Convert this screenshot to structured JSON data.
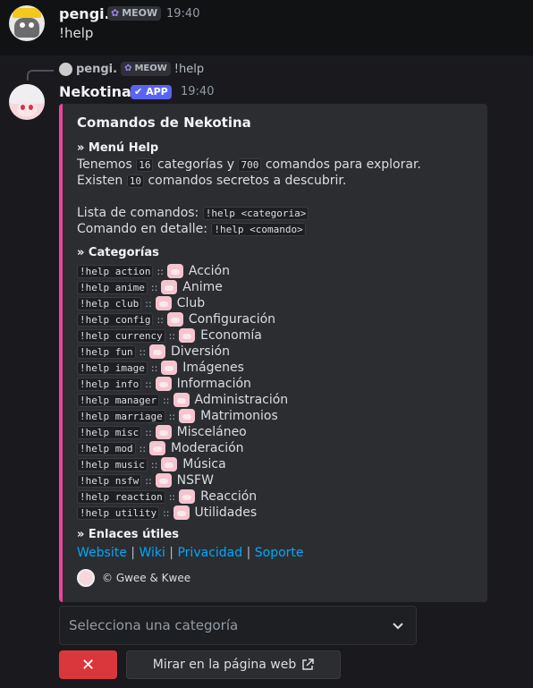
{
  "message1": {
    "username": "pengi.",
    "tag": "MEOW",
    "time": "19:40",
    "text": "!help"
  },
  "reply": {
    "username": "pengi.",
    "tag": "MEOW",
    "text": "!help"
  },
  "message2": {
    "username": "Nekotina",
    "app_tag": "APP",
    "time": "19:40"
  },
  "embed": {
    "title": "Comandos de Nekotina",
    "menu_header": "» Menú Help",
    "line1_a": "Tenemos",
    "line1_code1": "16",
    "line1_b": "categorías y",
    "line1_code2": "700",
    "line1_c": "comandos para explorar.",
    "line2_a": "Existen",
    "line2_code": "10",
    "line2_b": "comandos secretos a descubrir.",
    "list_label": "Lista de comandos:",
    "list_code": "!help <categoria>",
    "detail_label": "Comando en detalle:",
    "detail_code": "!help <comando>",
    "categories_header": "» Categorías",
    "categories": [
      {
        "cmd": "!help action",
        "label": "Acción"
      },
      {
        "cmd": "!help anime",
        "label": "Anime"
      },
      {
        "cmd": "!help club",
        "label": "Club"
      },
      {
        "cmd": "!help config",
        "label": "Configuración"
      },
      {
        "cmd": "!help currency",
        "label": "Economía"
      },
      {
        "cmd": "!help fun",
        "label": "Diversión"
      },
      {
        "cmd": "!help image",
        "label": "Imágenes"
      },
      {
        "cmd": "!help info",
        "label": "Información"
      },
      {
        "cmd": "!help manager",
        "label": "Administración"
      },
      {
        "cmd": "!help marriage",
        "label": "Matrimonios"
      },
      {
        "cmd": "!help misc",
        "label": "Misceláneo"
      },
      {
        "cmd": "!help mod",
        "label": "Moderación"
      },
      {
        "cmd": "!help music",
        "label": "Música"
      },
      {
        "cmd": "!help nsfw",
        "label": "NSFW"
      },
      {
        "cmd": "!help reaction",
        "label": "Reacción"
      },
      {
        "cmd": "!help utility",
        "label": "Utilidades"
      }
    ],
    "links_header": "» Enlaces útiles",
    "links": [
      "Website",
      "Wiki",
      "Privacidad",
      "Soporte"
    ],
    "footer": "© Gwee & Kwee"
  },
  "select": {
    "placeholder": "Selecciona una categoría"
  },
  "buttons": {
    "close": "✕",
    "web": "Mirar en la página web"
  },
  "colors": {
    "embed_accent": "#eb459e",
    "link": "#00a8fc",
    "danger": "#da373c",
    "app_badge": "#5865f2"
  }
}
